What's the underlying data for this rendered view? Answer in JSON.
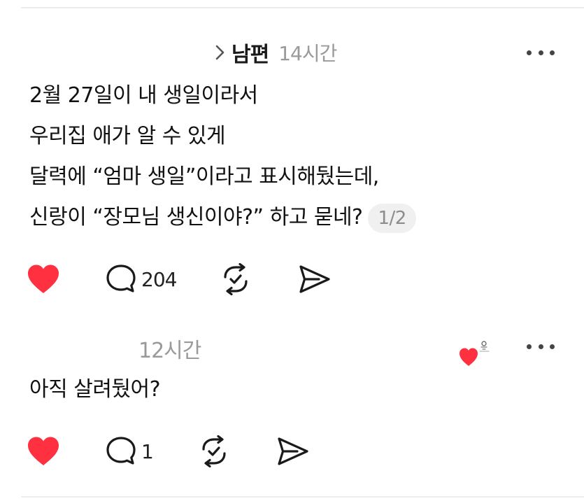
{
  "thread": {
    "post": {
      "username": "남편",
      "time": "14시간",
      "lines": [
        "2월 27일이 내 생일이라서",
        "우리집 애가 알 수 있게",
        "달력에 “엄마 생일”이라고 표시해뒀는데,",
        "신랑이 “장모님 생신이야?” 하고 묻네?"
      ],
      "page_indicator": "1/2",
      "reply_count": "204",
      "liked": true
    },
    "reply": {
      "time": "12시간",
      "text": "아직 살려뒀어?",
      "reply_count": "1",
      "liked": true
    }
  },
  "colors": {
    "like": "#ff3040",
    "icon": "#1a1a1a",
    "muted_text": "#9a9a9a"
  },
  "icons": {
    "chevron": "chevron-right-icon",
    "more": "more-horizontal-icon",
    "like": "heart-filled-icon",
    "comment": "comment-bubble-icon",
    "repost": "repost-icon",
    "share": "send-icon"
  }
}
